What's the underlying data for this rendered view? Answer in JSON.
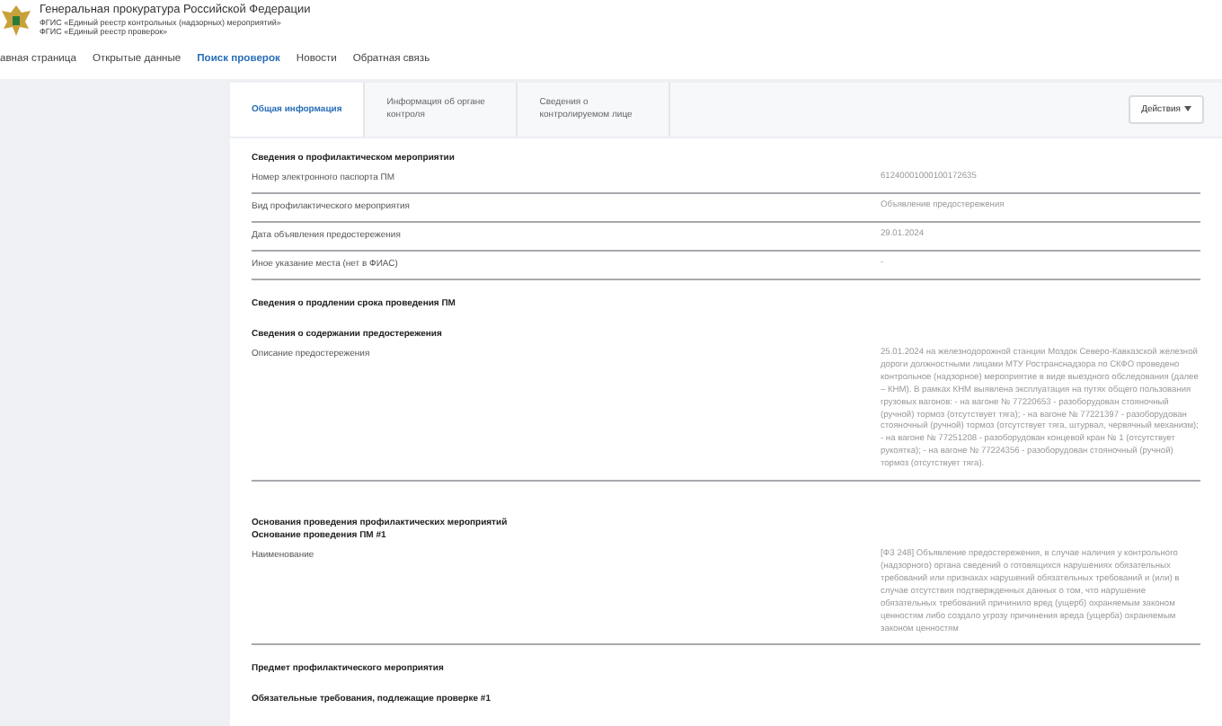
{
  "header": {
    "title": "Генеральная прокуратура Российской Федерации",
    "subtitles": [
      "ФГИС «Единый реестр контрольных (надзорных) мероприятий»",
      "ФГИС «Единый реестр проверок»"
    ]
  },
  "nav": [
    {
      "label": "авная страница",
      "selected": false
    },
    {
      "label": "Открытые данные",
      "selected": false
    },
    {
      "label": "Поиск проверок",
      "selected": true
    },
    {
      "label": "Новости",
      "selected": false
    },
    {
      "label": "Обратная связь",
      "selected": false
    }
  ],
  "tabs": [
    {
      "label": "Общая информация",
      "selected": true
    },
    {
      "label": "Информация об органе контроля",
      "selected": false
    },
    {
      "label": "Сведения о контролируемом лице",
      "selected": false
    }
  ],
  "actions_button": "Действия",
  "sections": [
    {
      "title": "Сведения о профилактическом мероприятии",
      "rows": [
        {
          "label": "Номер электронного паспорта ПМ",
          "value": "61240001000100172635"
        },
        {
          "label": "Вид профилактического мероприятия",
          "value": "Объявление предостережения"
        },
        {
          "label": "Дата объявления предостережения",
          "value": "29.01.2024"
        },
        {
          "label": "Иное указание места (нет в ФИАС)",
          "value": "-"
        }
      ]
    },
    {
      "title": "Сведения о продлении срока проведения ПМ"
    },
    {
      "title": "Сведения о содержании предостережения",
      "rows": [
        {
          "label": "Описание предостережения",
          "value": "25.01.2024 на железнодорожной станции Моздок Северо-Кавказской железной дороги должностными лицами МТУ Ространснадзора по СКФО проведено контрольное (надзорное) мероприятие в виде выездного обследования (далее – КНМ). В рамках КНМ выявлена эксплуатация на путях общего пользования грузовых вагонов: - на вагоне № 77220653 - разоборудован стояночный (ручной) тормоз (отсутствует тяга); - на вагоне № 77221397 - разоборудован стояночный (ручной) тормоз (отсутствует тяга, штурвал, червячный механизм); - на вагоне № 77251208 - разоборудован концевой кран № 1 (отсутствует рукоятка); - на вагоне № 77224356 - разоборудован стояночный (ручной) тормоз (отсутствует тяга)."
        }
      ]
    },
    {
      "title": "Основания проведения профилактических мероприятий",
      "subtitle": "Основание проведения ПМ #1",
      "rows": [
        {
          "label": "Наименование",
          "value": "[ФЗ 248] Объявление предостережения, в случае наличия у контрольного (надзорного) органа сведений о готовящихся нарушениях обязательных требований или признаках нарушений обязательных требований и (или) в случае отсутствия подтвержденных данных о том, что нарушение обязательных требований причинило вред (ущерб) охраняемым законом ценностям либо создало угрозу причинения вреда (ущерба) охраняемым законом ценностям"
        }
      ]
    },
    {
      "title": "Предмет профилактического мероприятия"
    },
    {
      "title": "Обязательные требования, подлежащие проверке #1"
    }
  ]
}
